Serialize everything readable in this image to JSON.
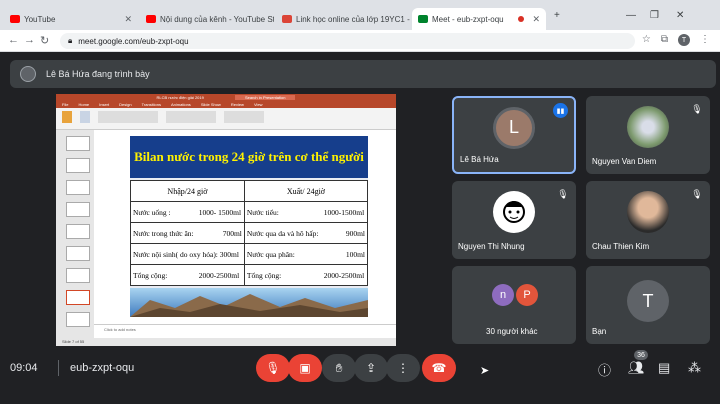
{
  "browser": {
    "tabs": [
      {
        "label": "YouTube",
        "color": "#ff0000"
      },
      {
        "label": "Nội dung của kênh - YouTube St",
        "color": "#ff0000"
      },
      {
        "label": "Link học online của lớp 19YC1 -",
        "color": "#db4437"
      },
      {
        "label": "Meet - eub-zxpt-oqu",
        "color": "#00832d"
      }
    ],
    "url": "meet.google.com/eub-zxpt-oqu",
    "profile_initial": "T"
  },
  "banner": {
    "text": "Lê Bá Hứa đang trình bày"
  },
  "presentation": {
    "window_title": "RLCB nước điện giải 2019",
    "search_placeholder": "Search in Presentation",
    "menu": [
      "File",
      "Home",
      "Insert",
      "Design",
      "Transitions",
      "Animations",
      "Slide Show",
      "Review",
      "View"
    ],
    "notes_placeholder": "Click to add notes",
    "status": "Slide 7 of 55",
    "slide_title": "Bilan nước trong 24 giờ trên cơ thể người",
    "table": {
      "headers": [
        "Nhập/24 giờ",
        "Xuất/ 24giờ"
      ],
      "rows": [
        [
          "Nước uống :",
          "1000- 1500ml",
          "Nước tiểu:",
          "1000-1500ml"
        ],
        [
          "Nước trong thức ăn:",
          "700ml",
          "Nước qua da và hô hấp:",
          "900ml"
        ],
        [
          "Nước nội sinh( do oxy hóa): 300ml",
          "",
          "Nước qua phân:",
          "100ml"
        ],
        [
          "Tổng cộng:",
          "2000-2500ml",
          "Tổng cộng:",
          "2000-2500ml"
        ]
      ]
    }
  },
  "participants": [
    {
      "name": "Lê Bá Hứa",
      "initial": "L",
      "color": "#9b7a6a"
    },
    {
      "name": "Nguyen Van Diem",
      "initial": "",
      "color": "#8aa68f"
    },
    {
      "name": "Nguyen Thi Nhung",
      "initial": "",
      "color": "#ffffff"
    },
    {
      "name": "Chau Thien Kim",
      "initial": "",
      "color": "#c7a48a"
    },
    {
      "name": "30 người khác",
      "initials": [
        "n",
        "P"
      ],
      "colors": [
        "#8e6cbf",
        "#e2553b"
      ]
    },
    {
      "name": "Bạn",
      "initial": "T",
      "color": "#5f6368"
    }
  ],
  "bottom_bar": {
    "time": "09:04",
    "meeting_code": "eub-zxpt-oqu",
    "participant_count": "36"
  }
}
